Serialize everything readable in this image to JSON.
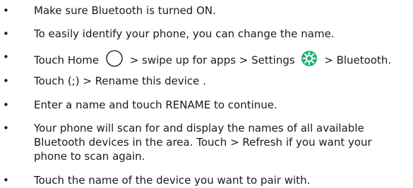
{
  "colors": {
    "text": "#1a1a1a",
    "settings_icon": "#19b36b",
    "home_icon_stroke": "#333333"
  },
  "bullets": [
    {
      "text": "Make sure Bluetooth is turned ON."
    },
    {
      "text": "To easily identify your phone, you can change the name."
    },
    {
      "pre": "Touch Home",
      "mid": "> swipe up for apps > Settings",
      "post": "> Bluetooth."
    },
    {
      "text": "Touch (;)  > Rename this device ."
    },
    {
      "text": "Enter a name and touch RENAME to continue."
    },
    {
      "line1": "Your phone will scan for and display the names of all available",
      "line2": "Bluetooth devices in the area. Touch  > Refresh if you want your",
      "line3": "phone to scan again."
    },
    {
      "text": "Touch the name of the device you want to pair with."
    }
  ],
  "bullet_glyph": "•",
  "icons": [
    "home-circle-icon",
    "settings-gear-icon"
  ]
}
